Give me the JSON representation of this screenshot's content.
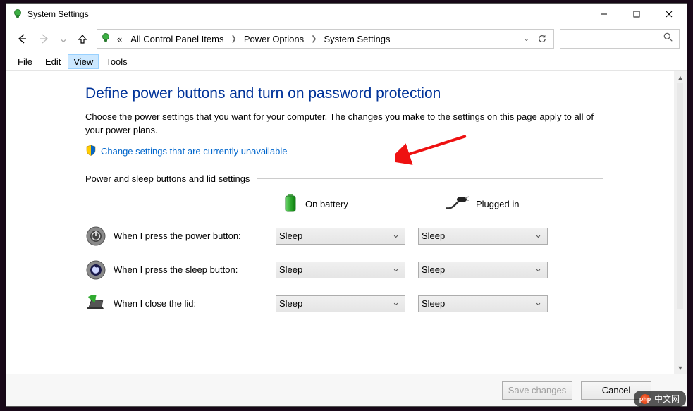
{
  "window": {
    "title": "System Settings"
  },
  "nav": {
    "breadcrumb_root": "«",
    "crumbs": [
      "All Control Panel Items",
      "Power Options",
      "System Settings"
    ]
  },
  "menubar": {
    "items": [
      "File",
      "Edit",
      "View",
      "Tools"
    ],
    "active_index": 2
  },
  "page": {
    "title": "Define power buttons and turn on password protection",
    "description": "Choose the power settings that you want for your computer. The changes you make to the settings on this page apply to all of your power plans.",
    "change_link": "Change settings that are currently unavailable",
    "section_header": "Power and sleep buttons and lid settings",
    "columns": {
      "battery": "On battery",
      "plugged": "Plugged in"
    },
    "rows": [
      {
        "label": "When I press the power button:",
        "battery": "Sleep",
        "plugged": "Sleep"
      },
      {
        "label": "When I press the sleep button:",
        "battery": "Sleep",
        "plugged": "Sleep"
      },
      {
        "label": "When I close the lid:",
        "battery": "Sleep",
        "plugged": "Sleep"
      }
    ]
  },
  "buttons": {
    "save": "Save changes",
    "cancel": "Cancel"
  },
  "watermark": "中文网",
  "watermark_prefix": "php"
}
